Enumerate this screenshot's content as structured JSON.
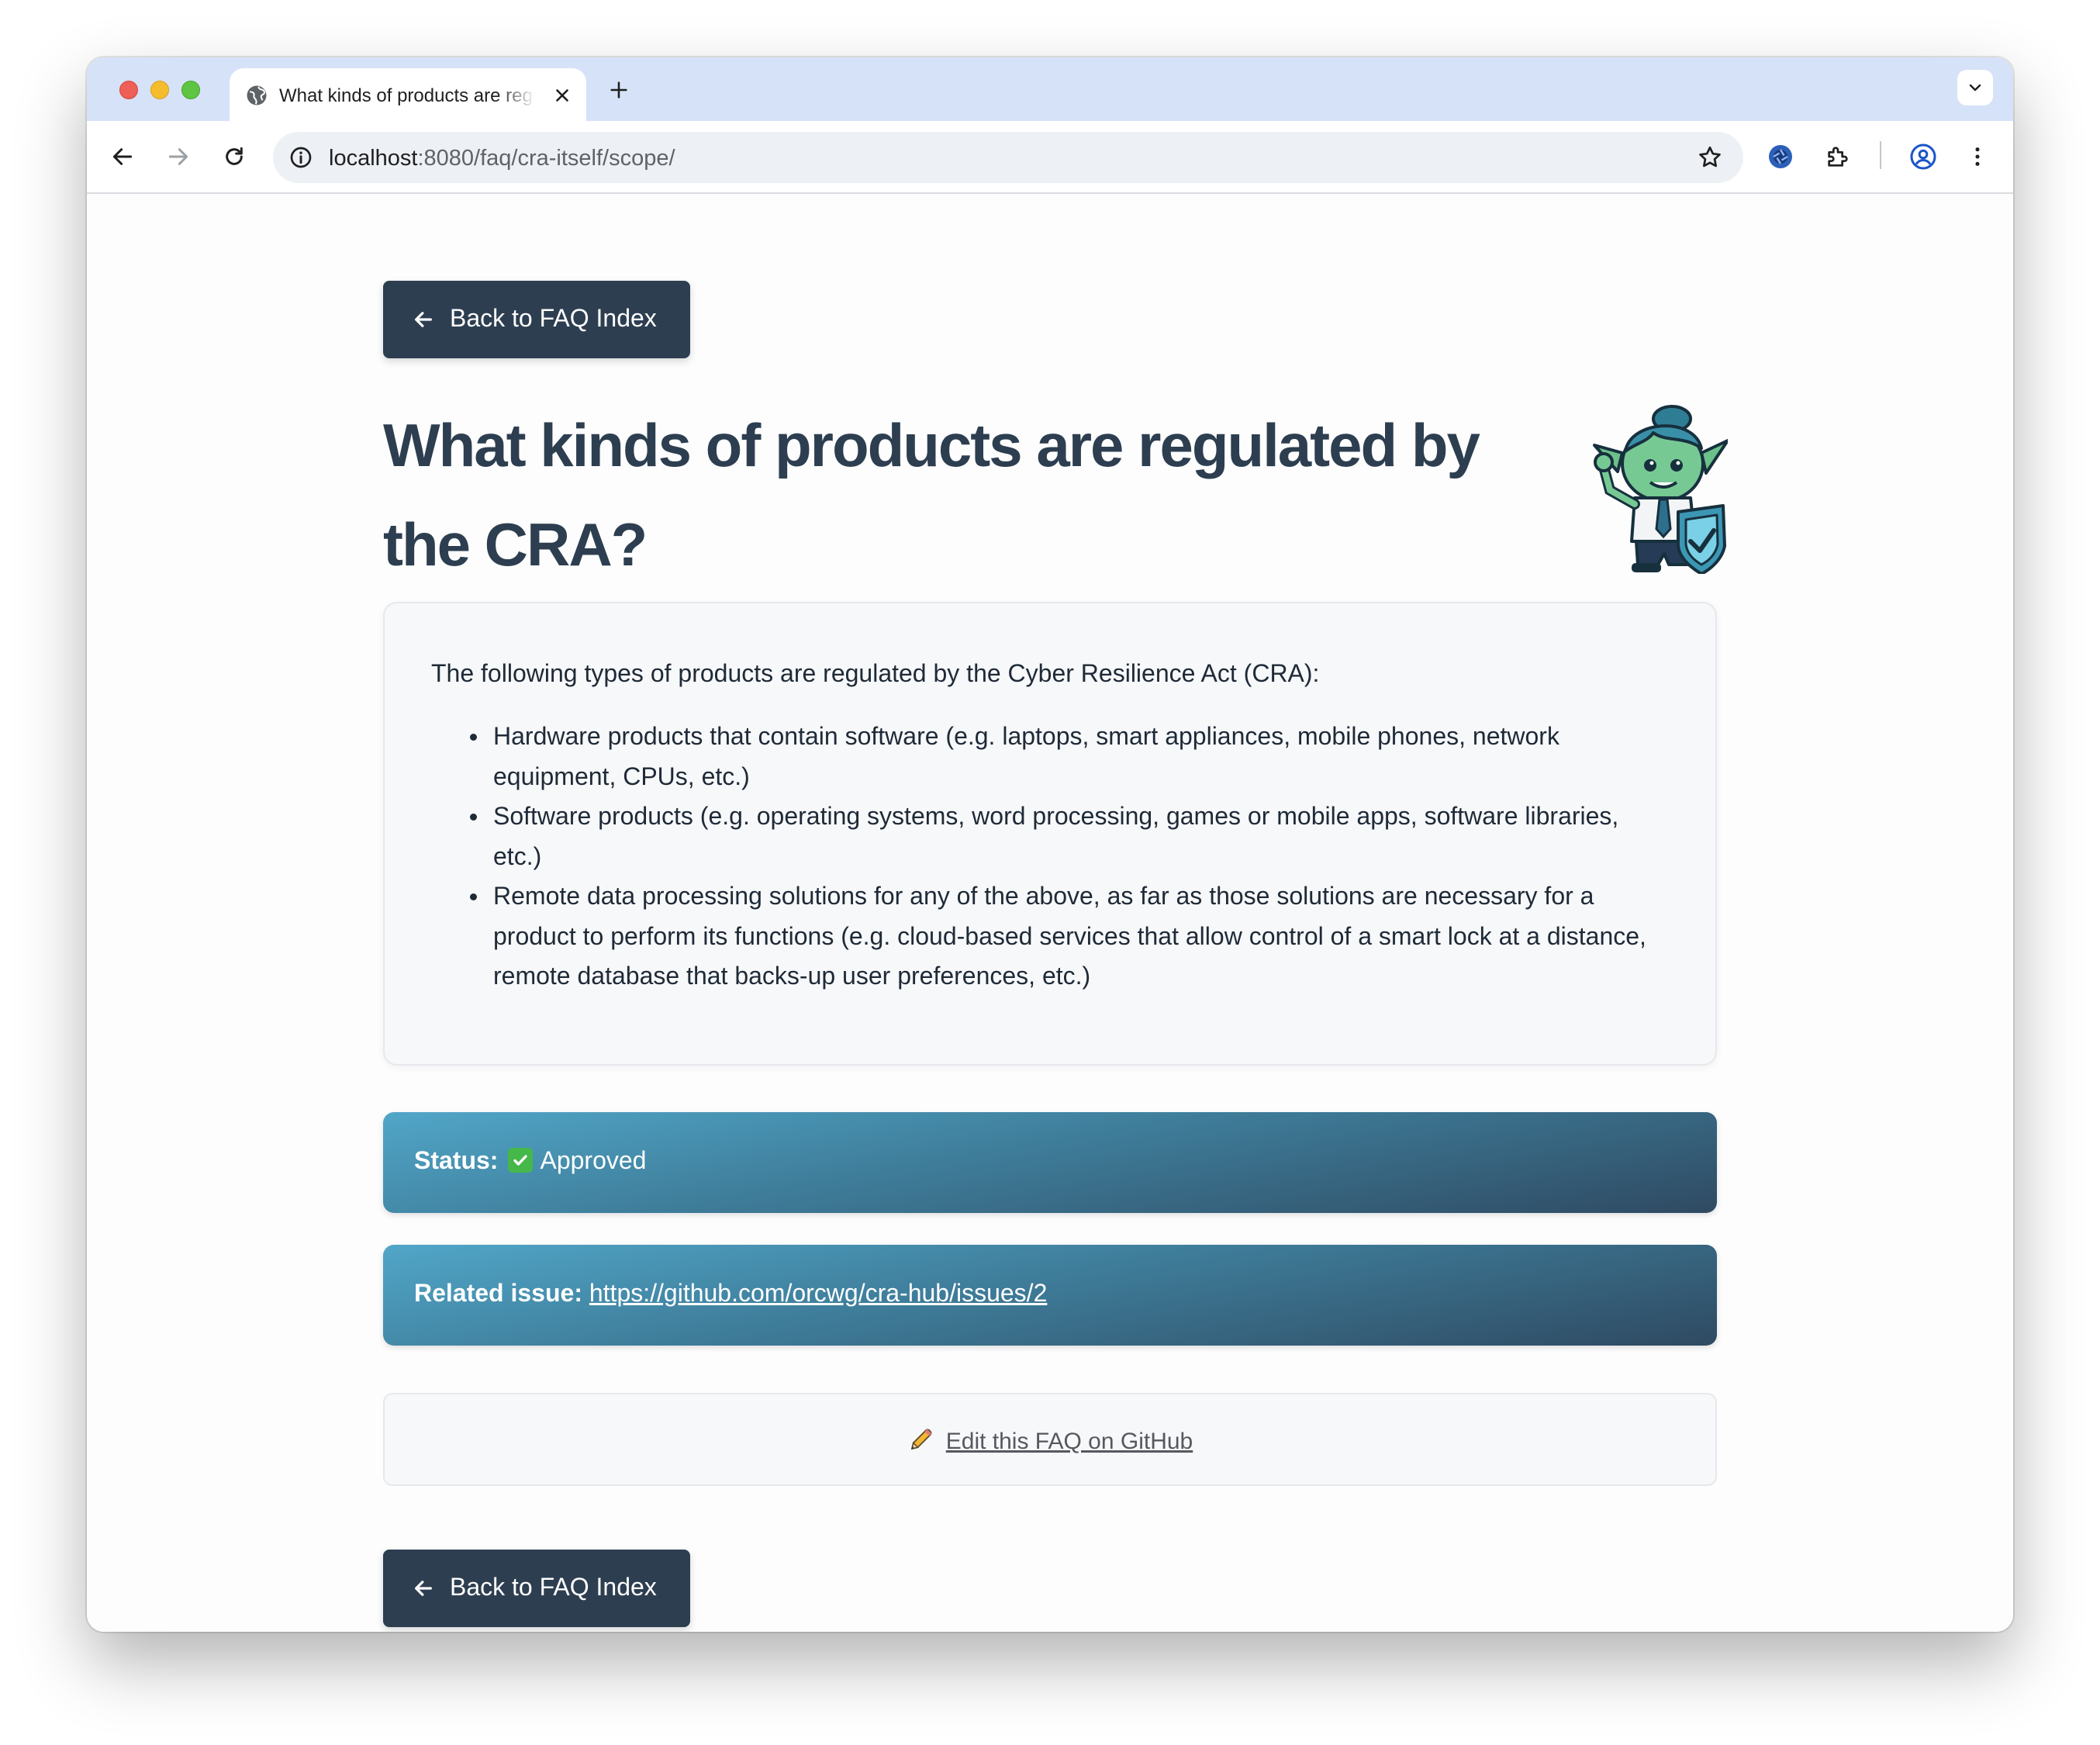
{
  "browser": {
    "tab_title": "What kinds of products are regulated by the CRA?",
    "url_host": "localhost",
    "url_path": ":8080/faq/cra-itself/scope/",
    "icons": {
      "tab_favicon": "globe-icon",
      "tab_close": "close-icon",
      "new_tab": "plus-icon",
      "tab_menu": "chevron-down-icon",
      "back": "arrow-left-icon",
      "forward": "arrow-right-icon",
      "reload": "reload-icon",
      "site_info": "info-icon",
      "bookmark": "star-icon",
      "extension_1": "aperture-icon",
      "extensions": "puzzle-icon",
      "profile": "profile-icon",
      "menu": "kebab-menu-icon"
    }
  },
  "page": {
    "back_button_label": "Back to FAQ Index",
    "title": "What kinds of products are regulated by the CRA?",
    "mascot": "goblin-mascot-with-shield",
    "answer": {
      "intro": "The following types of products are regulated by the Cyber Resilience Act (CRA):",
      "items": [
        "Hardware products that contain software (e.g. laptops, smart appliances, mobile phones, network equipment, CPUs, etc.)",
        "Software products (e.g. operating systems, word processing, games or mobile apps, software libraries, etc.)",
        "Remote data processing solutions for any of the above, as far as those solutions are necessary for a product to perform its functions (e.g. cloud-based services that allow control of a smart lock at a distance, remote database that backs-up user preferences, etc.)"
      ]
    },
    "status": {
      "label": "Status:",
      "value": "Approved",
      "icon": "check-mark-icon"
    },
    "related_issue": {
      "label": "Related issue:",
      "url": "https://github.com/orcwg/cra-hub/issues/2"
    },
    "edit": {
      "icon": "pencil-icon",
      "label": "Edit this FAQ on GitHub"
    }
  },
  "colors": {
    "tab_strip": "#d6e2f7",
    "button_bg": "#2d3e50",
    "title_text": "#2d3e50",
    "bar_gradient_light": "#51a6c8",
    "bar_gradient_dark": "#2f4a62",
    "check_green": "#45b849"
  }
}
